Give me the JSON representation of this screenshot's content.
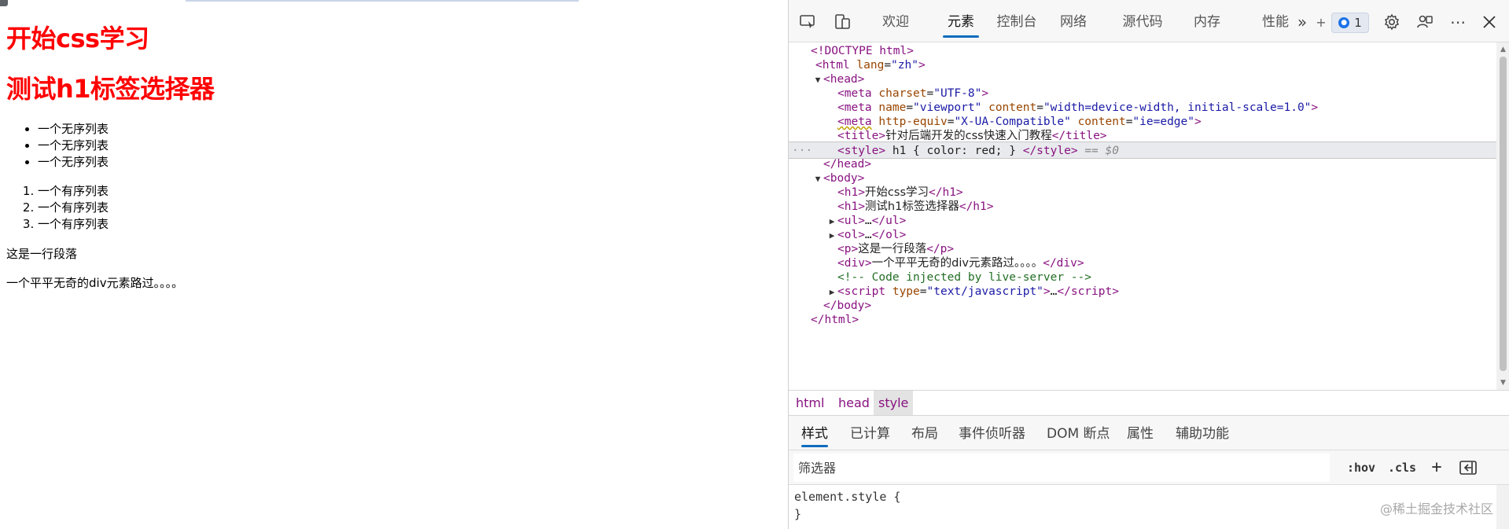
{
  "page": {
    "h1_first": "开始css学习",
    "h1_second": "测试h1标签选择器",
    "ul_items": [
      "一个无序列表",
      "一个无序列表",
      "一个无序列表"
    ],
    "ol_items": [
      "一个有序列表",
      "一个有序列表",
      "一个有序列表"
    ],
    "paragraph": "这是一行段落",
    "div_text": "一个平平无奇的div元素路过。。。。",
    "heading_color": "#ff0000"
  },
  "toolbar": {
    "tabs": [
      {
        "label": "欢迎",
        "active": false
      },
      {
        "label": "元素",
        "active": true
      },
      {
        "label": "控制台",
        "active": false
      },
      {
        "label": "网络",
        "active": false
      },
      {
        "label": "源代码",
        "active": false
      },
      {
        "label": "内存",
        "active": false
      },
      {
        "label": "性能",
        "active": false
      }
    ],
    "more_tabs": "»",
    "add_tab": "+",
    "issue_count": "1",
    "icons": [
      "inspect-icon",
      "device-emulation-icon",
      "more-tabs-icon",
      "issues-icon",
      "settings-icon",
      "customize-icon",
      "more-options-icon",
      "close-icon"
    ]
  },
  "dom": {
    "doctype": "<!DOCTYPE html>",
    "html_open": "html",
    "html_attr_name": "lang",
    "html_attr_value": "\"zh\"",
    "head": "head",
    "meta1_attr": "charset",
    "meta1_val": "\"UTF-8\"",
    "meta2_attr1": "name",
    "meta2_val1": "\"viewport\"",
    "meta2_attr2": "content",
    "meta2_val2": "\"width=device-width, initial-scale=1.0\"",
    "meta3_attr1": "http-equiv",
    "meta3_val1": "\"X-UA-Compatible\"",
    "meta3_attr2": "content",
    "meta3_val2": "\"ie=edge\"",
    "title_text": "针对后端开发的css快速入门教程",
    "style_text": " h1 { color: red; } ",
    "selected_marker": "== $0",
    "body": "body",
    "h1_a": "开始css学习",
    "h1_b": "测试h1标签选择器",
    "ellipsis": "…",
    "p_text": "这是一行段落",
    "div_text": "一个平平无奇的div元素路过。。。。",
    "comment": "<!-- Code injected by live-server -->",
    "script_attr": "type",
    "script_val": "\"text/javascript\""
  },
  "breadcrumb": [
    "html",
    "head",
    "style"
  ],
  "styles_tabs": [
    {
      "label": "样式",
      "active": true
    },
    {
      "label": "已计算",
      "active": false
    },
    {
      "label": "布局",
      "active": false
    },
    {
      "label": "事件侦听器",
      "active": false
    },
    {
      "label": "DOM 断点",
      "active": false
    },
    {
      "label": "属性",
      "active": false
    },
    {
      "label": "辅助功能",
      "active": false
    }
  ],
  "filter": {
    "placeholder": "筛选器",
    "hov": ":hov",
    "cls": ".cls",
    "new_rule": "+"
  },
  "style_block": {
    "line1": "element.style {",
    "line2": "}"
  },
  "watermark": "@稀土掘金技术社区"
}
